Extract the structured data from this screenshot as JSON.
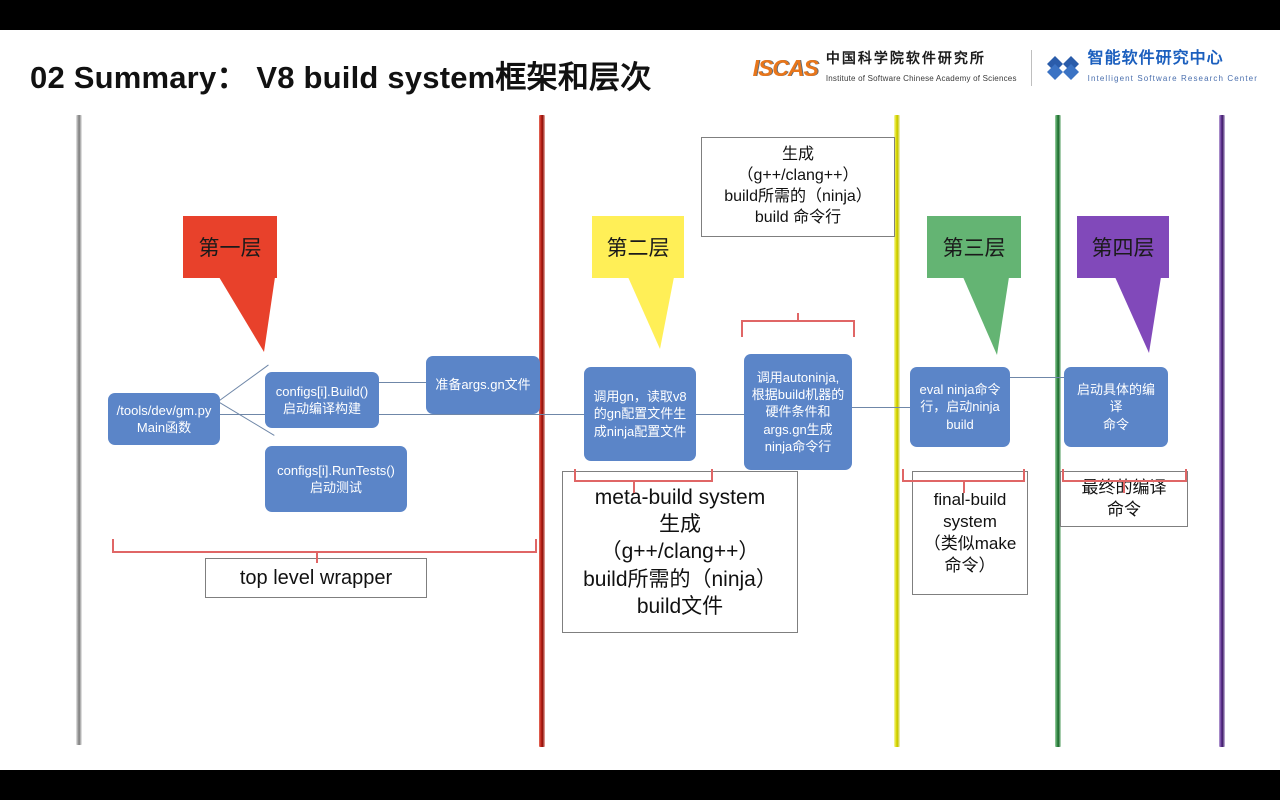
{
  "header": {
    "title": "02 Summary： V8 build system框架和层次",
    "logos": [
      {
        "mark": "ISCAS",
        "cn": "中国科学院软件研究所",
        "en": "Institute of Software Chinese Academy of Sciences"
      },
      {
        "mark": "isrc-logo-icon",
        "cn": "智能软件研究中心",
        "en": "Intelligent Software Research Center"
      }
    ]
  },
  "colors": {
    "divider_gray": "#a6a6a6",
    "divider_red": "#c00000",
    "divider_yellow": "#d9d900",
    "divider_green": "#2e8540",
    "divider_purple": "#5b2d8e",
    "callout_red": "#e8412b",
    "callout_yellow": "#ffef57",
    "callout_green": "#64b473",
    "callout_purple": "#8149ba",
    "process_blue": "#5b85c8",
    "bracket_red": "#e06666"
  },
  "dividers": [
    {
      "name": "divider-gray",
      "color": "#a6a6a6"
    },
    {
      "name": "divider-red",
      "color": "#c00000"
    },
    {
      "name": "divider-yellow",
      "color": "#d9d900"
    },
    {
      "name": "divider-green",
      "color": "#2e8540"
    },
    {
      "name": "divider-purple",
      "color": "#5b2d8e"
    }
  ],
  "callouts": [
    {
      "label": "第一层",
      "color": "#e8412b"
    },
    {
      "label": "第二层",
      "color": "#ffef57"
    },
    {
      "label": "第三层",
      "color": "#64b473"
    },
    {
      "label": "第四层",
      "color": "#8149ba"
    }
  ],
  "process_boxes": {
    "gm_main": "/tools/dev/gm.py\nMain函数",
    "gm_main_l1": "/tools/dev/gm.py",
    "gm_main_l2": "Main函数",
    "build_l1": "configs[i].Build()",
    "build_l2": "启动编译构建",
    "runtests_l1": "configs[i].RunTests()",
    "runtests_l2": "启动测试",
    "argsgn": "准备args.gn文件",
    "gn_l1": "调用gn，读取v8",
    "gn_l2": "的gn配置文件生",
    "gn_l3": "成ninja配置文件",
    "autoninja_l1": "调用autoninja,",
    "autoninja_l2": "根据build机器的",
    "autoninja_l3": "硬件条件和",
    "autoninja_l4": "args.gn生成",
    "autoninja_l5": "ninja命令行",
    "eval_l1": "eval ninja命令",
    "eval_l2": "行，启动ninja",
    "eval_l3": "build",
    "compile_l1": "启动具体的编译",
    "compile_l2": "命令"
  },
  "note_boxes": {
    "ninja_cmdline": {
      "l1": "生成",
      "l2": "（g++/clang++）",
      "l3": "build所需的（ninja）",
      "l4": "build 命令行"
    },
    "top_level_wrapper": {
      "l1": "top level wrapper"
    },
    "meta_build": {
      "l1": "meta-build system",
      "l2": "生成",
      "l3": "（g++/clang++）",
      "l4": "build所需的（ninja）",
      "l5": "build文件"
    },
    "final_build": {
      "l1": "final-build",
      "l2": "system",
      "l3": "（类似make",
      "l4": "命令）"
    },
    "final_compile_cmd": {
      "l1": "最终的编译",
      "l2": "命令"
    }
  }
}
